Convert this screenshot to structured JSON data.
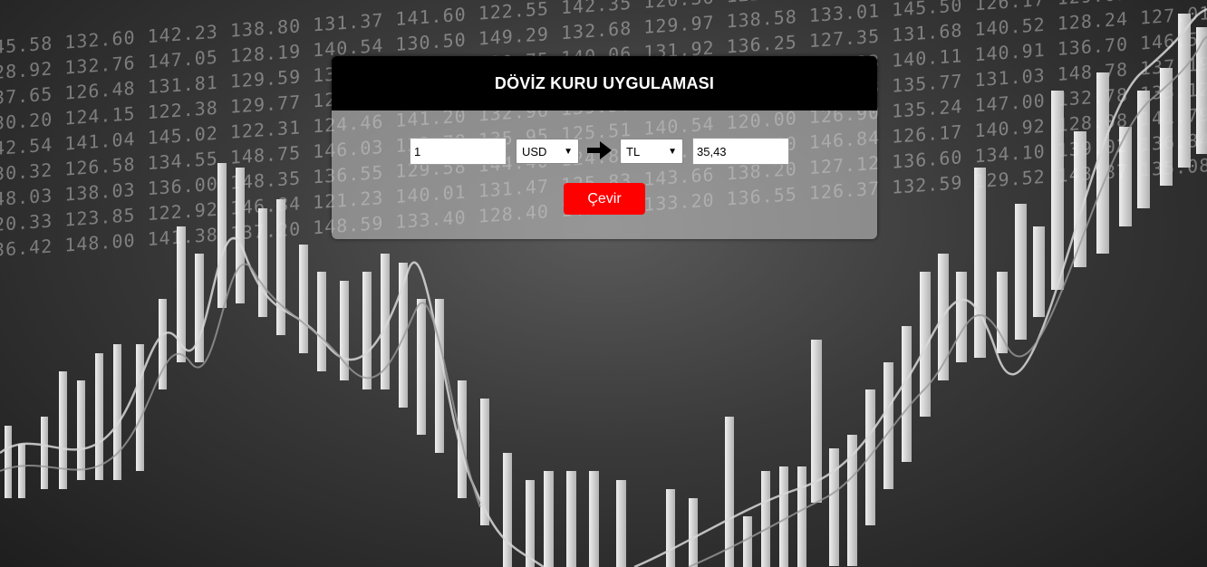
{
  "app": {
    "title": "DÖVİZ KURU UYGULAMASI"
  },
  "converter": {
    "amount_value": "1",
    "from_currency": "USD",
    "to_currency": "TL",
    "result_value": "35,43",
    "arrow_icon": "right-arrow-icon",
    "convert_label": "Çevir"
  },
  "colors": {
    "header_bg": "#000000",
    "button_bg": "#ff0000",
    "button_text": "#ffffff"
  }
}
